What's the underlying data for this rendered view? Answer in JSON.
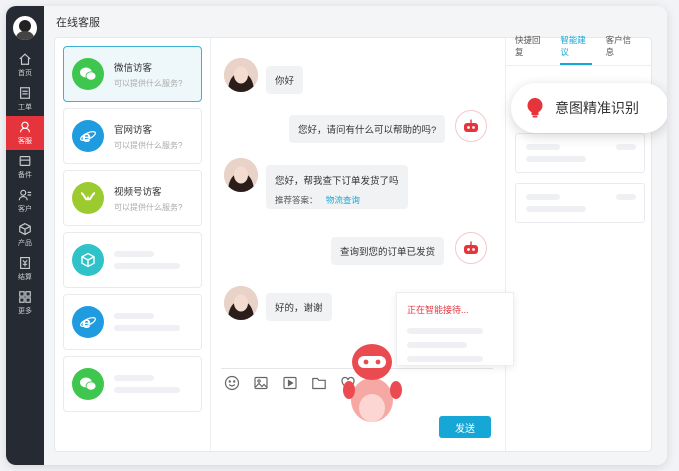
{
  "page": {
    "title": "在线客服"
  },
  "nav": {
    "items": [
      {
        "label": "首页",
        "icon": "home-icon"
      },
      {
        "label": "工单",
        "icon": "ticket-icon"
      },
      {
        "label": "客服",
        "icon": "service-icon"
      },
      {
        "label": "备件",
        "icon": "parts-icon"
      },
      {
        "label": "客户",
        "icon": "customer-icon"
      },
      {
        "label": "产品",
        "icon": "product-icon"
      },
      {
        "label": "结算",
        "icon": "settlement-icon"
      },
      {
        "label": "更多",
        "icon": "more-icon"
      }
    ],
    "active": "客服"
  },
  "visitors": [
    {
      "name": "微信访客",
      "sub": "可以提供什么服务?",
      "icon": "wechat-icon",
      "color": "#3ec64e"
    },
    {
      "name": "官网访客",
      "sub": "可以提供什么服务?",
      "icon": "ie-icon",
      "color": "#1f9be0"
    },
    {
      "name": "视频号访客",
      "sub": "可以提供什么服务?",
      "icon": "video-channel-icon",
      "color": "#9ccb2f"
    }
  ],
  "chat": {
    "messages": [
      {
        "from": "visitor",
        "text": "你好"
      },
      {
        "from": "agent",
        "text": "您好，请问有什么可以帮助的吗?"
      },
      {
        "from": "visitor",
        "text": "您好，帮我查下订单发货了吗",
        "suggestion_label": "推荐答案：",
        "suggestion_link": "物流查询"
      },
      {
        "from": "agent",
        "text": "查询到您的订单已发货"
      },
      {
        "from": "visitor",
        "text": "好的，谢谢"
      }
    ],
    "send_label": "发送",
    "popup_text": "正在智能接待..."
  },
  "right_panel": {
    "tabs": [
      "快捷回复",
      "智能建议",
      "客户信息"
    ],
    "active_tab": "智能建议",
    "badge_text": "意图精准识别"
  },
  "colors": {
    "accent": "#16a7d6",
    "brand_red": "#e6343c",
    "nav_bg": "#262b33"
  }
}
